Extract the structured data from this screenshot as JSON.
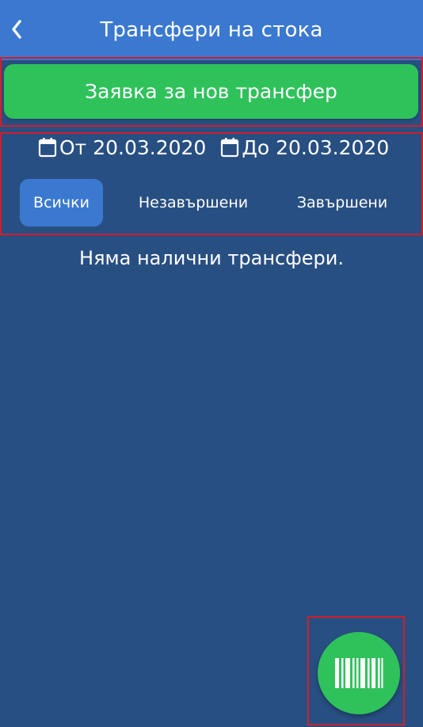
{
  "header": {
    "title": "Трансфери на стока",
    "back_icon": "chevron-left-icon"
  },
  "actions": {
    "new_transfer_label": "Заявка за нов трансфер"
  },
  "date_filter": {
    "from_label": "От 20.03.2020",
    "to_label": "До 20.03.2020",
    "icon": "calendar-icon"
  },
  "tabs": [
    {
      "label": "Всички",
      "selected": true
    },
    {
      "label": "Незавършени",
      "selected": false
    },
    {
      "label": "Завършени",
      "selected": false
    }
  ],
  "empty_message": "Няма налични трансфери.",
  "fab": {
    "icon": "barcode-icon"
  },
  "colors": {
    "background": "#284f82",
    "header": "#3b79d0",
    "accent_green": "#2fc25b",
    "selected_tab": "#3b79d0",
    "highlight": "#d01f2a"
  }
}
